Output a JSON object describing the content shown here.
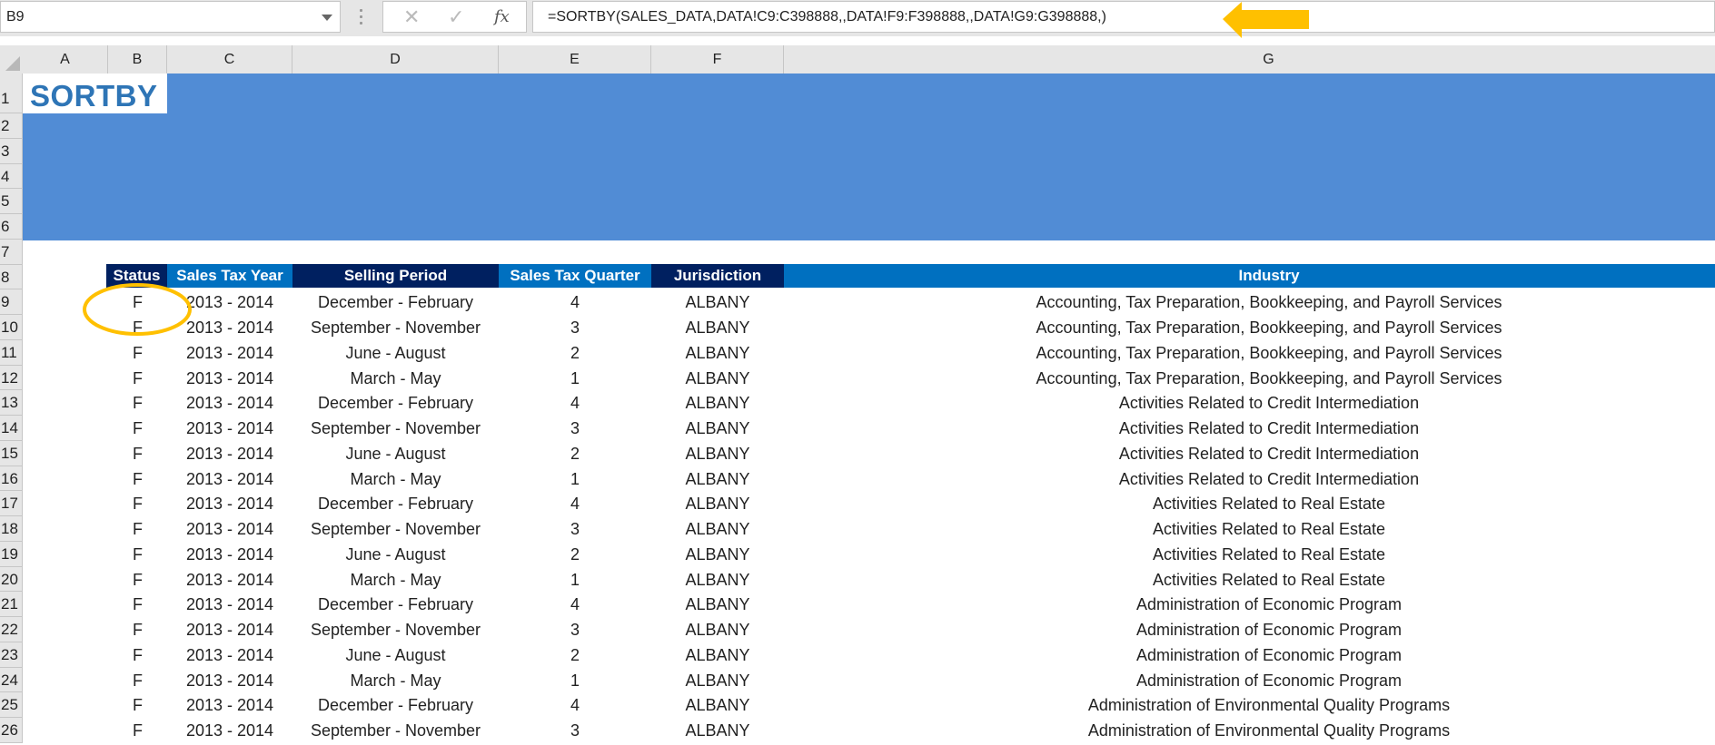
{
  "formula_bar": {
    "name_box": "B9",
    "cancel_icon": "✕",
    "enter_icon": "✓",
    "fx_label": "fx",
    "formula": "=SORTBY(SALES_DATA,DATA!C9:C398888,,DATA!F9:F398888,,DATA!G9:G398888,)"
  },
  "columns": [
    "A",
    "B",
    "C",
    "D",
    "E",
    "F",
    "G"
  ],
  "title": "SORTBY",
  "row_numbers": [
    "1",
    "2",
    "3",
    "4",
    "5",
    "6",
    "7",
    "8",
    "9",
    "10",
    "11",
    "12",
    "13",
    "14",
    "15",
    "16",
    "17",
    "18",
    "19",
    "20",
    "21",
    "22",
    "23",
    "24",
    "25",
    "26"
  ],
  "table": {
    "headers": [
      "Status",
      "Sales Tax Year",
      "Selling Period",
      "Sales Tax Quarter",
      "Jurisdiction",
      "Industry"
    ],
    "rows": [
      [
        "F",
        "2013 - 2014",
        "December - February",
        "4",
        "ALBANY",
        "Accounting, Tax Preparation, Bookkeeping, and Payroll Services"
      ],
      [
        "F",
        "2013 - 2014",
        "September - November",
        "3",
        "ALBANY",
        "Accounting, Tax Preparation, Bookkeeping, and Payroll Services"
      ],
      [
        "F",
        "2013 - 2014",
        "June - August",
        "2",
        "ALBANY",
        "Accounting, Tax Preparation, Bookkeeping, and Payroll Services"
      ],
      [
        "F",
        "2013 - 2014",
        "March - May",
        "1",
        "ALBANY",
        "Accounting, Tax Preparation, Bookkeeping, and Payroll Services"
      ],
      [
        "F",
        "2013 - 2014",
        "December - February",
        "4",
        "ALBANY",
        "Activities Related to Credit Intermediation"
      ],
      [
        "F",
        "2013 - 2014",
        "September - November",
        "3",
        "ALBANY",
        "Activities Related to Credit Intermediation"
      ],
      [
        "F",
        "2013 - 2014",
        "June - August",
        "2",
        "ALBANY",
        "Activities Related to Credit Intermediation"
      ],
      [
        "F",
        "2013 - 2014",
        "March - May",
        "1",
        "ALBANY",
        "Activities Related to Credit Intermediation"
      ],
      [
        "F",
        "2013 - 2014",
        "December - February",
        "4",
        "ALBANY",
        "Activities Related to Real Estate"
      ],
      [
        "F",
        "2013 - 2014",
        "September - November",
        "3",
        "ALBANY",
        "Activities Related to Real Estate"
      ],
      [
        "F",
        "2013 - 2014",
        "June - August",
        "2",
        "ALBANY",
        "Activities Related to Real Estate"
      ],
      [
        "F",
        "2013 - 2014",
        "March - May",
        "1",
        "ALBANY",
        "Activities Related to Real Estate"
      ],
      [
        "F",
        "2013 - 2014",
        "December - February",
        "4",
        "ALBANY",
        "Administration of Economic Program"
      ],
      [
        "F",
        "2013 - 2014",
        "September - November",
        "3",
        "ALBANY",
        "Administration of Economic Program"
      ],
      [
        "F",
        "2013 - 2014",
        "June - August",
        "2",
        "ALBANY",
        "Administration of Economic Program"
      ],
      [
        "F",
        "2013 - 2014",
        "March - May",
        "1",
        "ALBANY",
        "Administration of Economic Program"
      ],
      [
        "F",
        "2013 - 2014",
        "December - February",
        "4",
        "ALBANY",
        "Administration of Environmental Quality Programs"
      ],
      [
        "F",
        "2013 - 2014",
        "September - November",
        "3",
        "ALBANY",
        "Administration of Environmental Quality Programs"
      ]
    ]
  },
  "colors": {
    "banner": "#518cd5",
    "title_text": "#2e75b6",
    "header_navy": "#002060",
    "header_blue": "#0070c0",
    "annotation": "#ffc000"
  }
}
